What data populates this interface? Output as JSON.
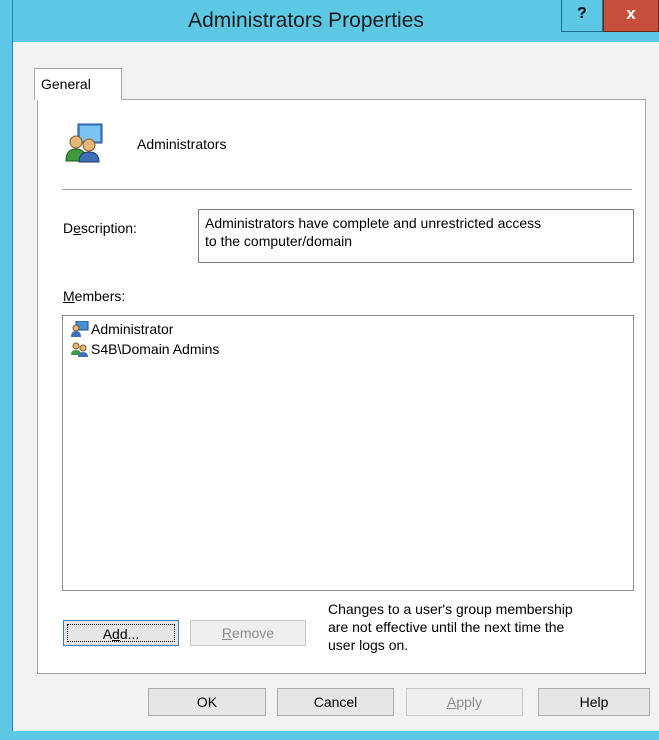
{
  "window": {
    "title": "Administrators Properties",
    "help_glyph": "?",
    "close_glyph": "x"
  },
  "tabs": [
    {
      "label": "General"
    }
  ],
  "group": {
    "icon": "group-icon",
    "name": "Administrators"
  },
  "description": {
    "label_prefix": "D",
    "label_accel": "e",
    "label_suffix": "scription:",
    "line1": "Administrators have complete and unrestricted access",
    "line2": "to the computer/domain"
  },
  "members": {
    "label_accel": "M",
    "label_suffix": "embers:",
    "items": [
      {
        "icon": "user-icon",
        "name": "Administrator"
      },
      {
        "icon": "group-icon",
        "name": "S4B\\Domain Admins"
      }
    ]
  },
  "buttons": {
    "add_prefix": "A",
    "add_accel": "d",
    "add_suffix": "d...",
    "remove_accel": "R",
    "remove_suffix": "emove",
    "ok": "OK",
    "cancel": "Cancel",
    "apply_accel": "A",
    "apply_suffix": "pply",
    "help": "Help"
  },
  "note": {
    "line1": "Changes to a user's group membership",
    "line2": "are not effective until the next time the",
    "line3": "user logs on."
  },
  "colors": {
    "frame": "#5dc8e4",
    "close": "#c7503c"
  }
}
